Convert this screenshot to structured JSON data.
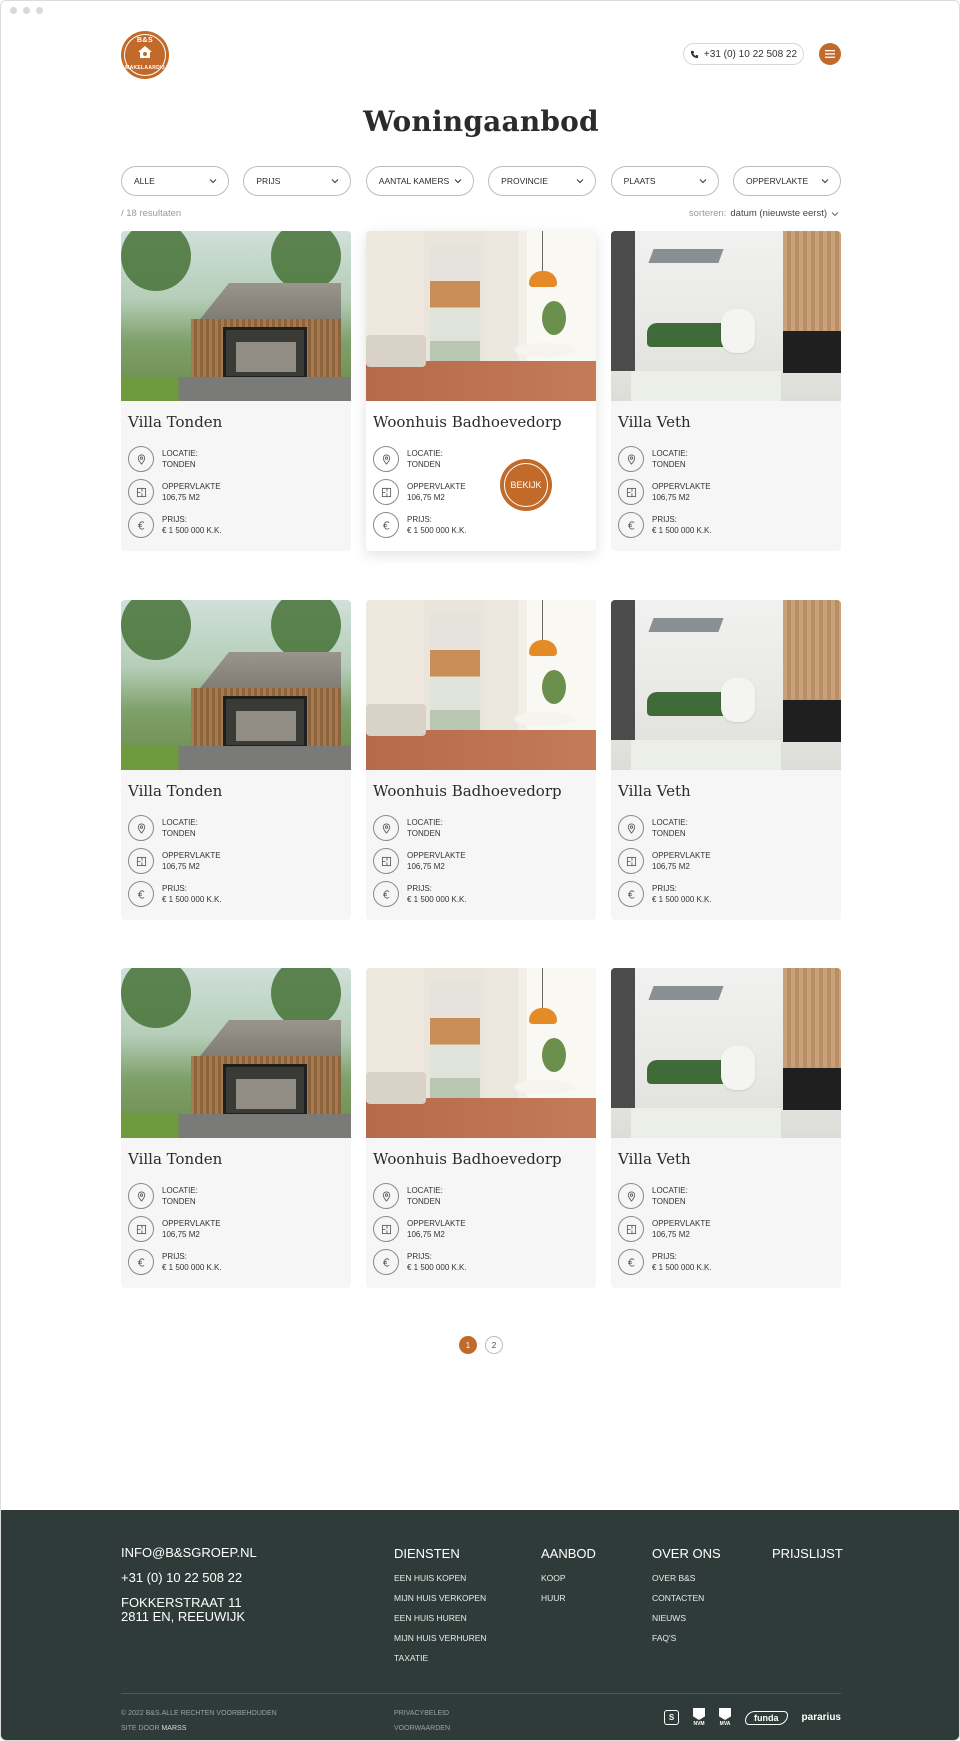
{
  "header": {
    "logo_text": "B&S",
    "logo_ring_text": "MAKELAARDIJ",
    "phone": "+31 (0) 10 22 508 22"
  },
  "page_title": "Woningaanbod",
  "filters": [
    "ALLE",
    "PRIJS",
    "AANTAL KAMERS",
    "PROVINCIE",
    "PLAATS",
    "OPPERVLAKTE"
  ],
  "results_text": "/ 18 resultaten",
  "sort": {
    "label": "sorteren:",
    "value": "datum (nieuwste eerst)"
  },
  "card_labels": {
    "location": "LOCATIE:",
    "area": "OPPERVLAKTE",
    "price": "PRIJS:",
    "cta": "BEKIJK"
  },
  "listings": [
    {
      "title": "Villa Tonden",
      "location": "TONDEN",
      "area": "106,75 M2",
      "price": "€ 1 500 000 K.K."
    },
    {
      "title": "Woonhuis Badhoevedorp",
      "location": "TONDEN",
      "area": "106,75 M2",
      "price": "€ 1 500 000 K.K."
    },
    {
      "title": "Villa Veth",
      "location": "TONDEN",
      "area": "106,75 M2",
      "price": "€ 1 500 000 K.K."
    },
    {
      "title": "Villa Tonden",
      "location": "TONDEN",
      "area": "106,75 M2",
      "price": "€ 1 500 000 K.K."
    },
    {
      "title": "Woonhuis Badhoevedorp",
      "location": "TONDEN",
      "area": "106,75 M2",
      "price": "€ 1 500 000 K.K."
    },
    {
      "title": "Villa Veth",
      "location": "TONDEN",
      "area": "106,75 M2",
      "price": "€ 1 500 000 K.K."
    },
    {
      "title": "Villa Tonden",
      "location": "TONDEN",
      "area": "106,75 M2",
      "price": "€ 1 500 000 K.K."
    },
    {
      "title": "Woonhuis Badhoevedorp",
      "location": "TONDEN",
      "area": "106,75 M2",
      "price": "€ 1 500 000 K.K."
    },
    {
      "title": "Villa Veth",
      "location": "TONDEN",
      "area": "106,75 M2",
      "price": "€ 1 500 000 K.K."
    }
  ],
  "pagination": [
    "1",
    "2"
  ],
  "footer": {
    "email": "INFO@B&SGROEP.NL",
    "phone": "+31 (0) 10 22 508 22",
    "address_line1": "FOKKERSTRAAT 11",
    "address_line2": "2811 EN, REEUWIJK",
    "columns": [
      {
        "heading": "DIENSTEN",
        "links": [
          "EEN HUIS KOPEN",
          "MIJN HUIS VERKOPEN",
          "EEN HUIS HUREN",
          "MIJN HUIS VERHUREN",
          "TAXATIE"
        ]
      },
      {
        "heading": "AANBOD",
        "links": [
          "KOOP",
          "HUUR"
        ]
      },
      {
        "heading": "OVER ONS",
        "links": [
          "OVER B&S",
          "CONTACTEN",
          "NIEUWS",
          "FAQ'S"
        ]
      },
      {
        "heading": "PRIJSLIJST",
        "links": []
      }
    ],
    "copyright": "© 2022 B&S.ALLE RECHTEN VOORBEHOUDEN",
    "site_by_label": "SITE DOOR",
    "site_by_name": "MARSS",
    "legal": [
      "PRIVACYBELEID",
      "VOORWAARDEN"
    ],
    "partners": [
      "S",
      "NVM",
      "MVA",
      "funda",
      "pararius"
    ]
  },
  "colors": {
    "accent": "#c26a2a",
    "footer_bg": "#2f3b38",
    "card_bg": "#f6f6f6"
  },
  "icons": {
    "phone": "phone-icon",
    "menu": "hamburger-icon",
    "location": "map-pin-icon",
    "area": "floorplan-icon",
    "price": "euro-icon",
    "chevron": "chevron-down-icon"
  }
}
